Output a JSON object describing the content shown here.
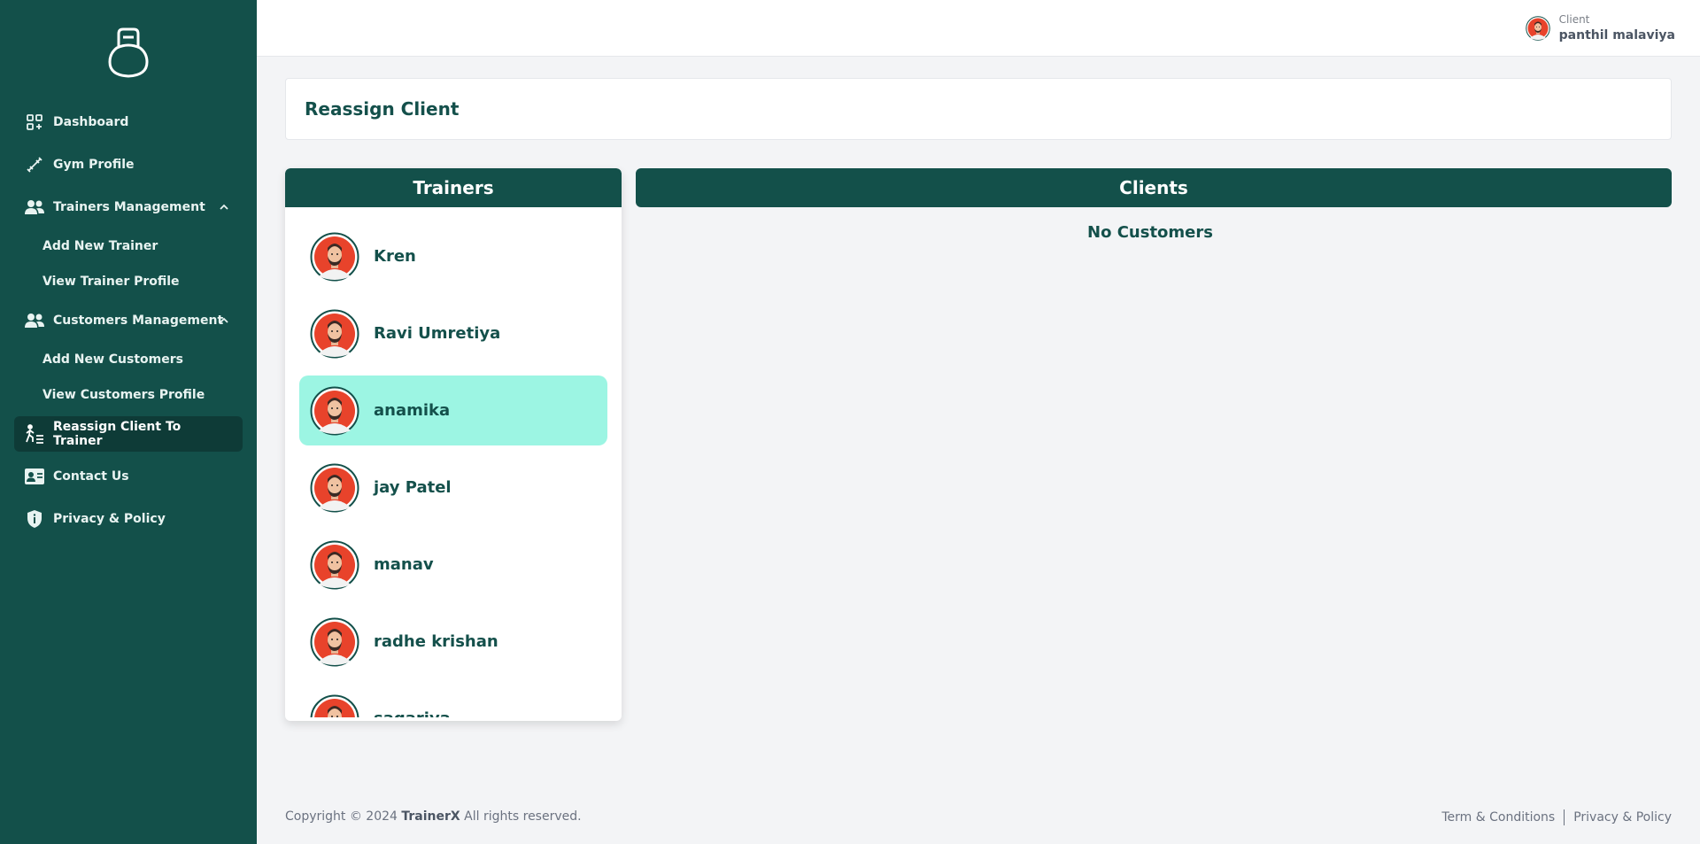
{
  "sidebar": {
    "logo_icon": "kettlebell-icon",
    "items": [
      {
        "label": "Dashboard",
        "icon": "dashboard-icon"
      },
      {
        "label": "Gym Profile",
        "icon": "dumbbell-icon"
      },
      {
        "label": "Trainers Management",
        "icon": "users-icon"
      },
      {
        "label": "Customers Management",
        "icon": "users-icon"
      },
      {
        "label": "Reassign Client To Trainer",
        "icon": "reassign-icon"
      },
      {
        "label": "Contact Us",
        "icon": "contact-card-icon"
      },
      {
        "label": "Privacy & Policy",
        "icon": "shield-icon"
      }
    ],
    "trainers_sub": [
      "Add New Trainer",
      "View Trainer Profile"
    ],
    "customers_sub": [
      "Add New Customers",
      "View Customers Profile"
    ],
    "active_item": "Reassign Client To Trainer"
  },
  "header": {
    "user_role": "Client",
    "user_name": "panthil malaviya"
  },
  "main": {
    "page_title": "Reassign Client",
    "trainers_title": "Trainers",
    "clients_title": "Clients",
    "no_customers": "No Customers",
    "trainers": [
      "Kren",
      "Ravi Umretiya",
      "anamika",
      "jay Patel",
      "manav",
      "radhe krishan",
      "sagariya"
    ],
    "selected_trainer": "anamika"
  },
  "footer": {
    "copyright_prefix": "Copyright © 2024",
    "brand": "TrainerX",
    "copyright_suffix": "All rights reserved.",
    "terms": "Term & Conditions",
    "privacy": "Privacy & Policy"
  },
  "colors": {
    "sidebar_bg": "#13504a",
    "active_bg": "#0e3b37",
    "selected_trainer_bg": "#9cf5e3",
    "accent_text": "#14504b"
  }
}
